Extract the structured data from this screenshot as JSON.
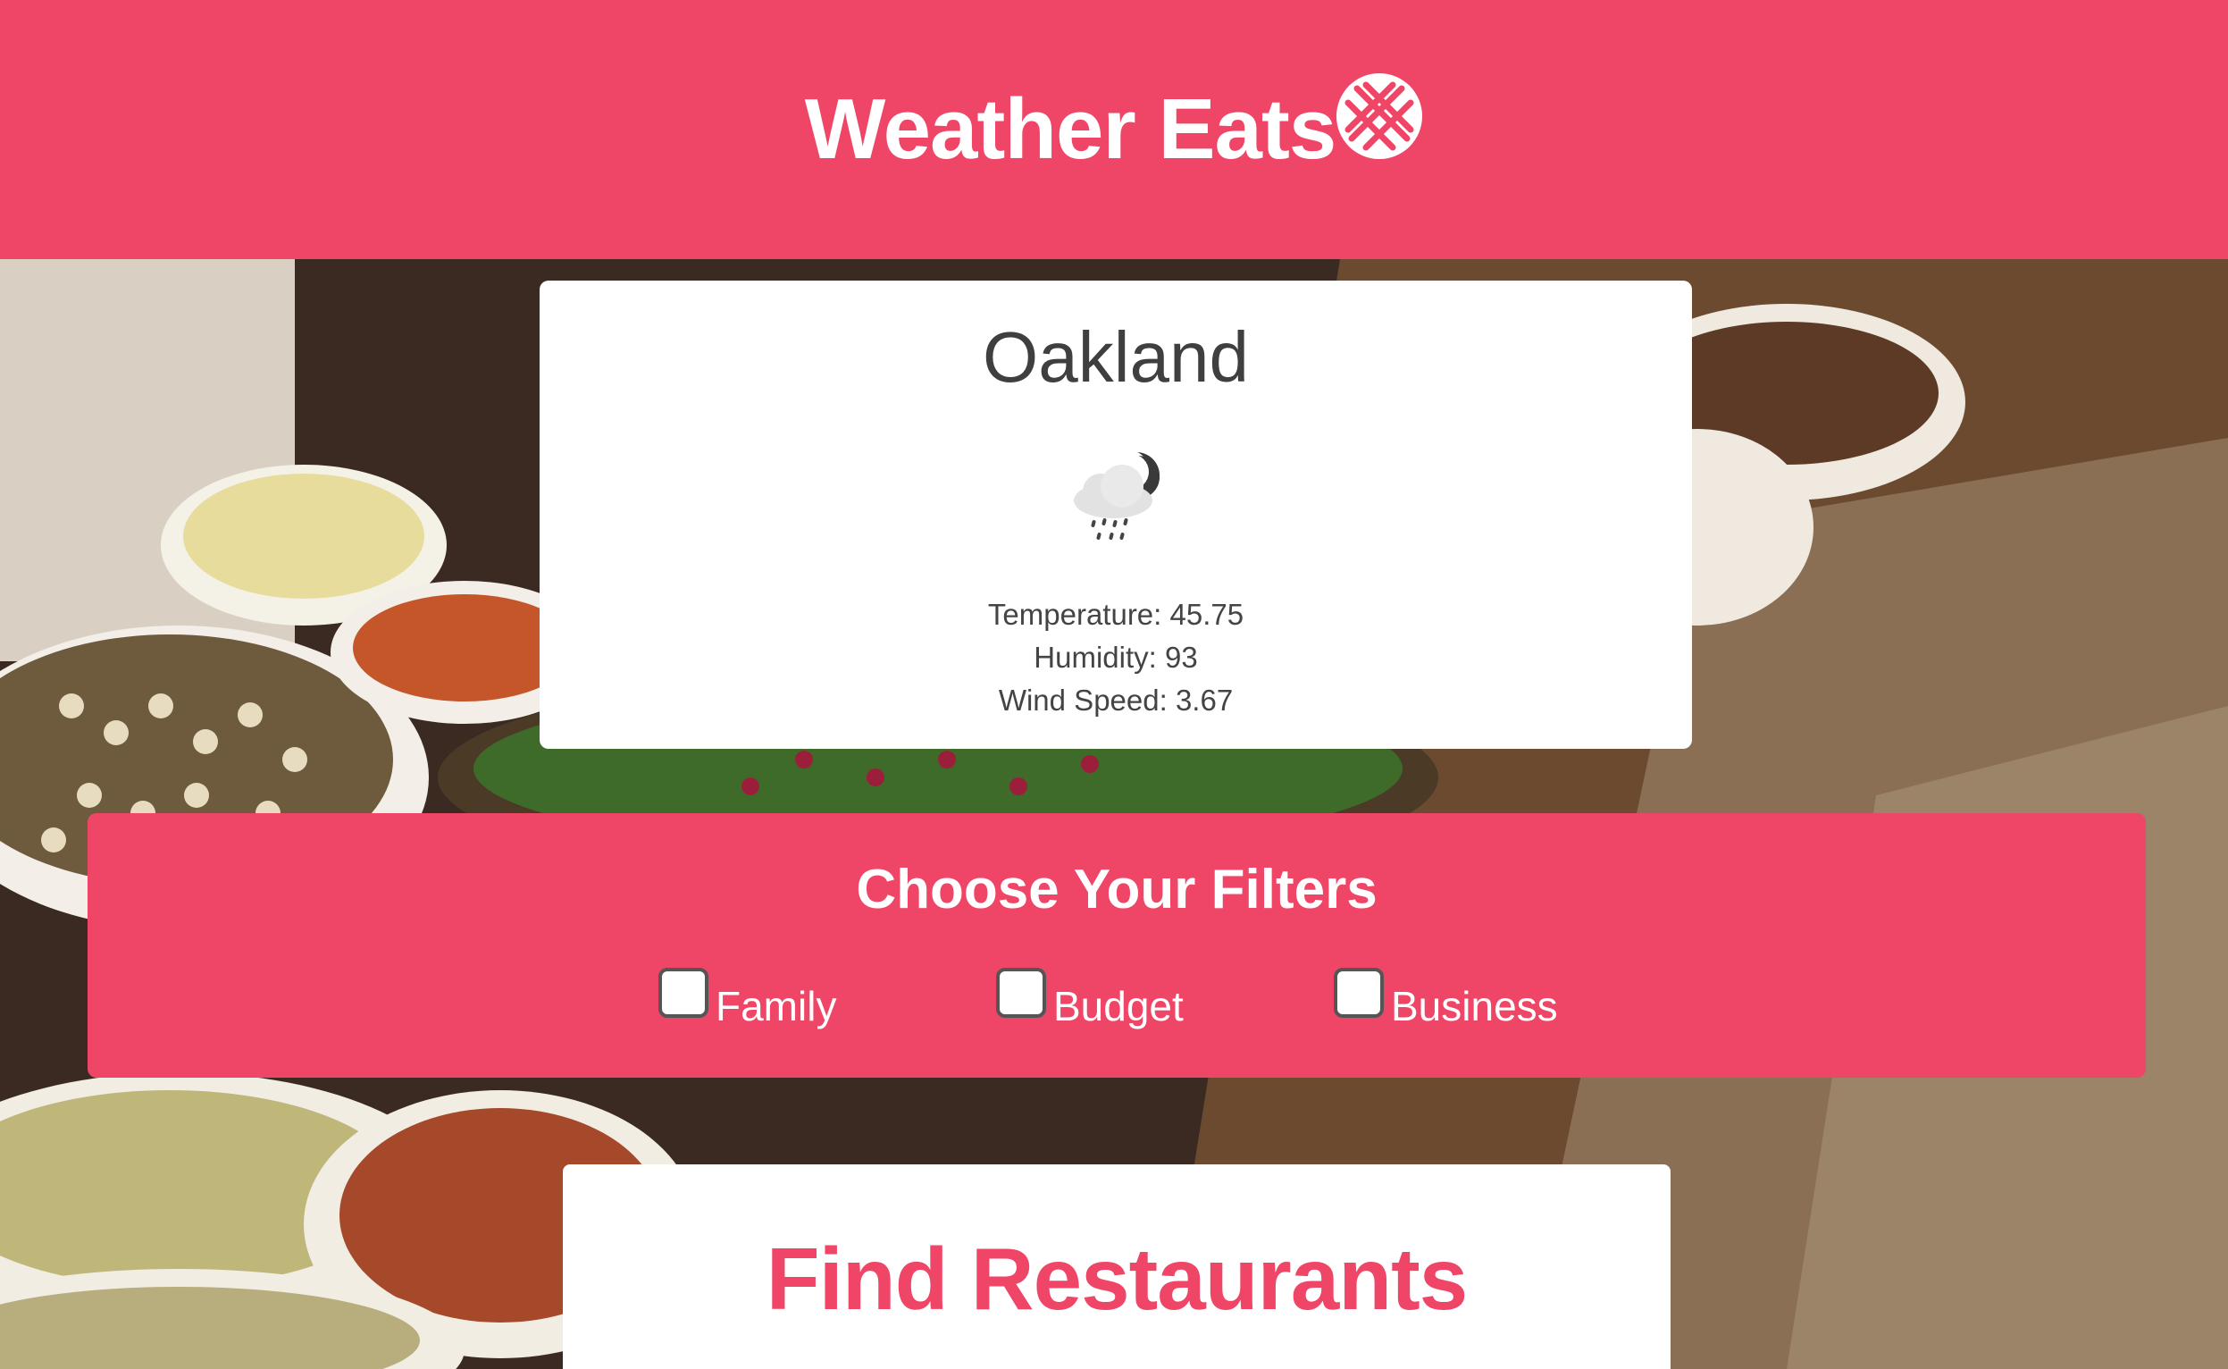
{
  "header": {
    "title": "Weather Eats",
    "logo_icon": "waffle-logo-icon",
    "background_color": "#ef4667"
  },
  "background": {
    "image": "food-table-photo"
  },
  "weather": {
    "city": "Oakland",
    "icon": "night-rain-cloud-icon",
    "temperature": "Temperature: 45.75",
    "humidity": "Humidity: 93",
    "wind_speed": "Wind Speed: 3.67"
  },
  "filters": {
    "title": "Choose Your Filters",
    "options": [
      {
        "label": "Family",
        "checked": false
      },
      {
        "label": "Budget",
        "checked": false
      },
      {
        "label": "Business",
        "checked": false
      }
    ]
  },
  "find": {
    "label": "Find Restaurants",
    "color": "#ef4667"
  }
}
